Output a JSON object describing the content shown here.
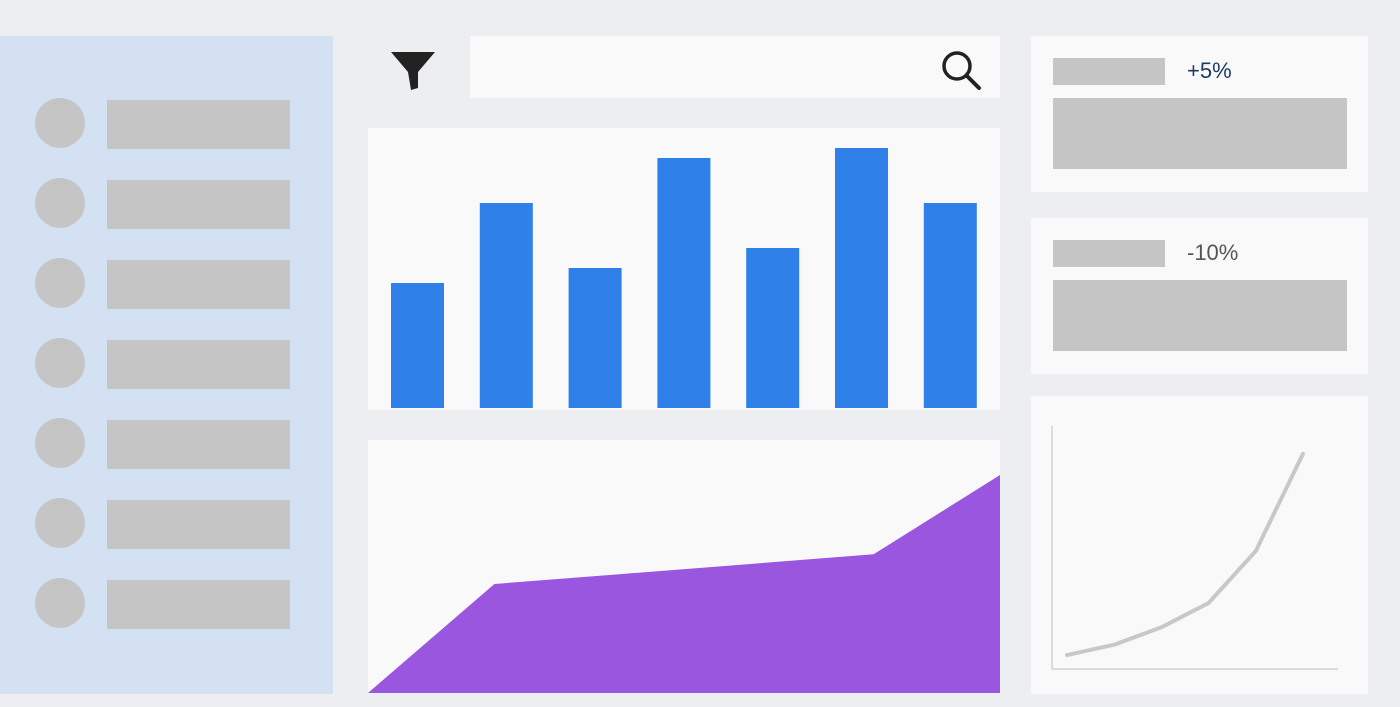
{
  "search": {
    "value": "",
    "placeholder": ""
  },
  "icons": {
    "filter": "filter-funnel-icon",
    "search": "search-magnifier-icon"
  },
  "sidebar": {
    "item_count": 7
  },
  "kpis": [
    {
      "value": "+5%",
      "color": "#1f3a5f"
    },
    {
      "value": "-10%",
      "color": "#555555"
    }
  ],
  "colors": {
    "bar": "#2f80e8",
    "area": "#9b56e0",
    "line": "#c8c8c8",
    "sidebar": "#d3e1f3"
  },
  "chart_data": [
    {
      "type": "bar",
      "categories": [
        "",
        "",
        "",
        "",
        "",
        "",
        ""
      ],
      "values": [
        25,
        41,
        28,
        50,
        32,
        52,
        41
      ],
      "ylim": [
        0,
        52
      ]
    },
    {
      "type": "area",
      "x": [
        0,
        1,
        2,
        3,
        4,
        5
      ],
      "values": [
        0,
        22,
        24,
        26,
        28,
        44
      ],
      "ylim": [
        0,
        44
      ]
    },
    {
      "type": "line",
      "x": [
        0,
        1,
        2,
        3,
        4,
        5
      ],
      "values": [
        4,
        7,
        12,
        19,
        34,
        62
      ],
      "ylim": [
        0,
        70
      ]
    }
  ]
}
